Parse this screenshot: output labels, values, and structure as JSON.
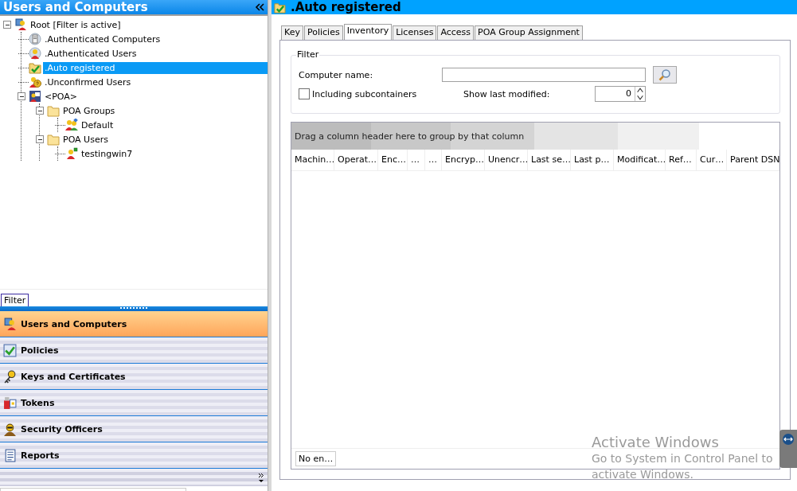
{
  "left_pane": {
    "title": "Users and Computers",
    "tree": [
      {
        "label": "Root [Filter is active]",
        "kind": "root",
        "expanded": true,
        "selected": false,
        "children": [
          {
            "label": ".Authenticated Computers",
            "kind": "computer",
            "selected": false
          },
          {
            "label": ".Authenticated Users",
            "kind": "user",
            "selected": false
          },
          {
            "label": ".Auto registered",
            "kind": "folder-check",
            "selected": true
          },
          {
            "label": ".Unconfirmed Users",
            "kind": "user-question",
            "selected": false
          },
          {
            "label": "<POA>",
            "kind": "poa",
            "expanded": true,
            "selected": false,
            "children": [
              {
                "label": "POA Groups",
                "kind": "folder",
                "expanded": true,
                "selected": false,
                "children": [
                  {
                    "label": "Default",
                    "kind": "group",
                    "selected": false
                  }
                ]
              },
              {
                "label": "POA Users",
                "kind": "folder",
                "expanded": true,
                "selected": false,
                "children": [
                  {
                    "label": "testingwin7",
                    "kind": "user-small",
                    "selected": false
                  }
                ]
              }
            ]
          }
        ]
      }
    ],
    "filter_tab": {
      "label": "Filter",
      "selected": true
    },
    "nav": [
      {
        "label": "Users and Computers",
        "kind": "users",
        "selected": true
      },
      {
        "label": "Policies",
        "kind": "policies",
        "selected": false
      },
      {
        "label": "Keys and Certificates",
        "kind": "keys",
        "selected": false
      },
      {
        "label": "Tokens",
        "kind": "tokens",
        "selected": false
      },
      {
        "label": "Security Officers",
        "kind": "officers",
        "selected": false
      },
      {
        "label": "Reports",
        "kind": "reports",
        "selected": false
      }
    ]
  },
  "right_pane": {
    "title": ".Auto registered",
    "tabs": [
      {
        "label": "Key",
        "selected": false
      },
      {
        "label": "Policies",
        "selected": false
      },
      {
        "label": "Inventory",
        "selected": true
      },
      {
        "label": "Licenses",
        "selected": false
      },
      {
        "label": "Access",
        "selected": false
      },
      {
        "label": "POA Group Assignment",
        "selected": false
      }
    ],
    "filter": {
      "legend": "Filter",
      "computer_name_label": "Computer name:",
      "include_subcontainers": {
        "label": "Including subcontainers",
        "checked": false
      },
      "show_last_modified_label": "Show last modified:",
      "show_last_modified_value": "0"
    },
    "grid": {
      "group_hint": "Drag a column header here to group by that column",
      "columns": [
        "Machin…",
        "Operat…",
        "Enc…",
        "…",
        "…",
        "Encryp…",
        "Unencr…",
        "Last se…",
        "Last p…",
        "Modificat…",
        "Ref…",
        "Cur…",
        "Parent DSN"
      ],
      "footer": "No en…"
    }
  },
  "os_notice": {
    "title": "Activate Windows",
    "lines": [
      "Go to System in Control Panel to",
      "activate Windows."
    ]
  }
}
